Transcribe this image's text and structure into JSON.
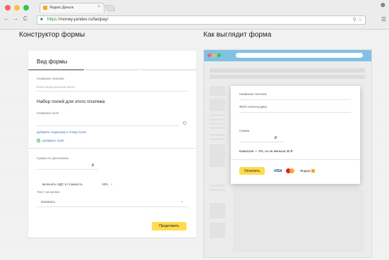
{
  "browser": {
    "tab_title": "Яндекс.Деньги",
    "tab_close": "×",
    "url_https": "https://",
    "url_rest": "money.yandex.ru/fastpay/",
    "dot_colors": [
      "#fc605c",
      "#fdbc40",
      "#34c84a"
    ]
  },
  "left": {
    "heading": "Конструктор формы",
    "card_title": "Вид формы",
    "progress_fraction": 0.33,
    "payment_name_label": "Название платежа",
    "payment_name_value": "Благотворительный взнос",
    "fields_heading": "Набор полей для этого платежа",
    "field_name_label": "Название поля",
    "add_hint_link": "добавить подсказку к этому полю",
    "add_field_link": "добавить поле",
    "default_sum_label": "Сумма по умолчанию",
    "currency": "₽",
    "vat_label": "включить НДС в стоимость",
    "vat_value": "18%",
    "button_text_label": "Текст на кнопке",
    "button_text_value": "Оплатить",
    "continue_button": "Продолжить"
  },
  "right": {
    "heading": "Как выглядит форма",
    "preview_bar_color": "#7fc2e6",
    "dot_colors": [
      "#fc605c",
      "#fdbc40",
      "#34c84a"
    ],
    "payment_name_label": "Название платежа",
    "payer_name_label": "ФИО плательщика",
    "sum_label": "Сумма",
    "currency": "₽",
    "commission_text": "Комиссия — 3%, но не меньше 30",
    "commission_currency": "₽",
    "pay_button": "Оплатить",
    "visa": "VISA",
    "yandex_money": "Яндекс"
  },
  "colors": {
    "accent_yellow": "#ffdb4d",
    "link_blue": "#3b6fc4",
    "success_green": "#3cab3c"
  }
}
